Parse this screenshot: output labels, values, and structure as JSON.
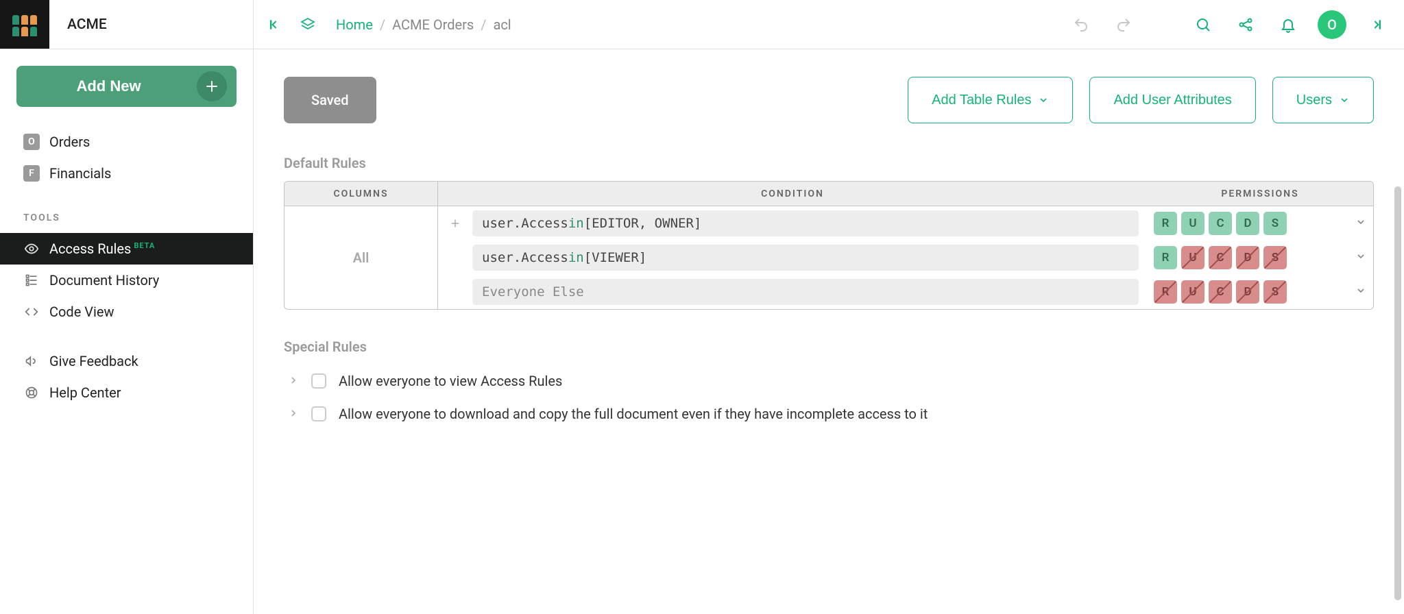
{
  "brand": "ACME",
  "add_new_label": "Add New",
  "sidebar": {
    "pages": [
      {
        "badge": "O",
        "label": "Orders"
      },
      {
        "badge": "F",
        "label": "Financials"
      }
    ],
    "tools_heading": "TOOLS",
    "tools": [
      {
        "id": "access-rules",
        "label": "Access Rules",
        "badge": "BETA",
        "active": true
      },
      {
        "id": "doc-history",
        "label": "Document History"
      },
      {
        "id": "code-view",
        "label": "Code View"
      }
    ],
    "footer": [
      {
        "id": "give-feedback",
        "label": "Give Feedback"
      },
      {
        "id": "help-center",
        "label": "Help Center"
      }
    ]
  },
  "breadcrumb": {
    "home": "Home",
    "doc": "ACME Orders",
    "page": "acl"
  },
  "avatar_initial": "O",
  "actions": {
    "saved": "Saved",
    "add_table_rules": "Add Table Rules",
    "add_user_attributes": "Add User Attributes",
    "users": "Users"
  },
  "default_rules": {
    "title": "Default Rules",
    "header_columns": "COLUMNS",
    "header_condition": "CONDITION",
    "header_permissions": "PERMISSIONS",
    "columns_label": "All",
    "rules": [
      {
        "condition_pre": "user.Access ",
        "condition_kw": "in",
        "condition_post": " [EDITOR, OWNER]",
        "perms": {
          "R": "g",
          "U": "g",
          "C": "g",
          "D": "g",
          "S": "g"
        }
      },
      {
        "condition_pre": "user.Access ",
        "condition_kw": "in",
        "condition_post": " [VIEWER]",
        "perms": {
          "R": "g",
          "U": "r",
          "C": "r",
          "D": "r",
          "S": "r"
        }
      },
      {
        "placeholder": "Everyone Else",
        "perms": {
          "R": "r",
          "U": "r",
          "C": "r",
          "D": "r",
          "S": "r"
        }
      }
    ]
  },
  "special": {
    "title": "Special Rules",
    "rules": [
      "Allow everyone to view Access Rules",
      "Allow everyone to download and copy the full document even if they have incomplete access to it"
    ]
  }
}
